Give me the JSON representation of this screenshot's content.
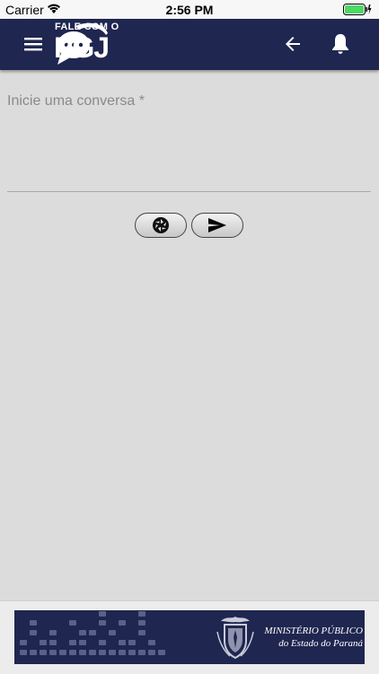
{
  "status_bar": {
    "carrier": "Carrier",
    "time": "2:56 PM"
  },
  "header": {
    "logo_top": "FALE COM O",
    "logo_main": "PGJ",
    "icons": [
      "menu-icon",
      "chat-bubbles-icon",
      "back-arrow-icon",
      "bell-icon"
    ]
  },
  "message": {
    "placeholder": "Inicie uma conversa *",
    "value": ""
  },
  "actions": {
    "icons": [
      "camera-shutter-icon",
      "send-icon"
    ]
  },
  "footer": {
    "line1": "MINISTÉRIO PÚBLICO",
    "line2": "do Estado do Paraná"
  },
  "colors": {
    "header_bg": "#1f2650",
    "page_bg": "#dcdcdc",
    "battery": "#4cd964"
  }
}
